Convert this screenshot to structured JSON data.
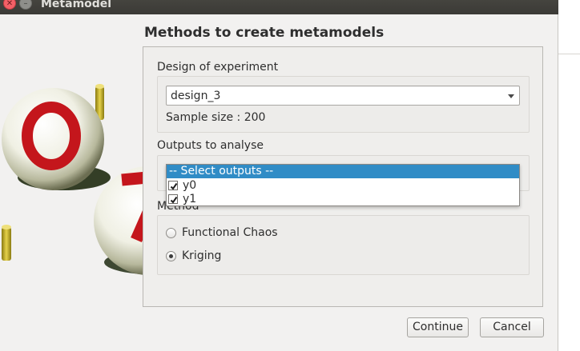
{
  "window": {
    "title": "Metamodel"
  },
  "dialog": {
    "heading": "Methods to create metamodels"
  },
  "design": {
    "label": "Design of experiment",
    "selected": "design_3",
    "sample_size_text": "Sample size : 200"
  },
  "outputs": {
    "label": "Outputs to analyse",
    "dropdown": {
      "header": "-- Select outputs --",
      "items": [
        {
          "label": "y0",
          "checked": true
        },
        {
          "label": "y1",
          "checked": true
        }
      ]
    }
  },
  "method": {
    "label": "Method",
    "options": [
      {
        "label": "Functional Chaos",
        "selected": false
      },
      {
        "label": "Kriging",
        "selected": true
      }
    ]
  },
  "buttons": {
    "continue": "Continue",
    "cancel": "Cancel"
  },
  "colors": {
    "selection": "#308cc6",
    "logo_red": "#c4161c",
    "close_button": "#f46067"
  }
}
